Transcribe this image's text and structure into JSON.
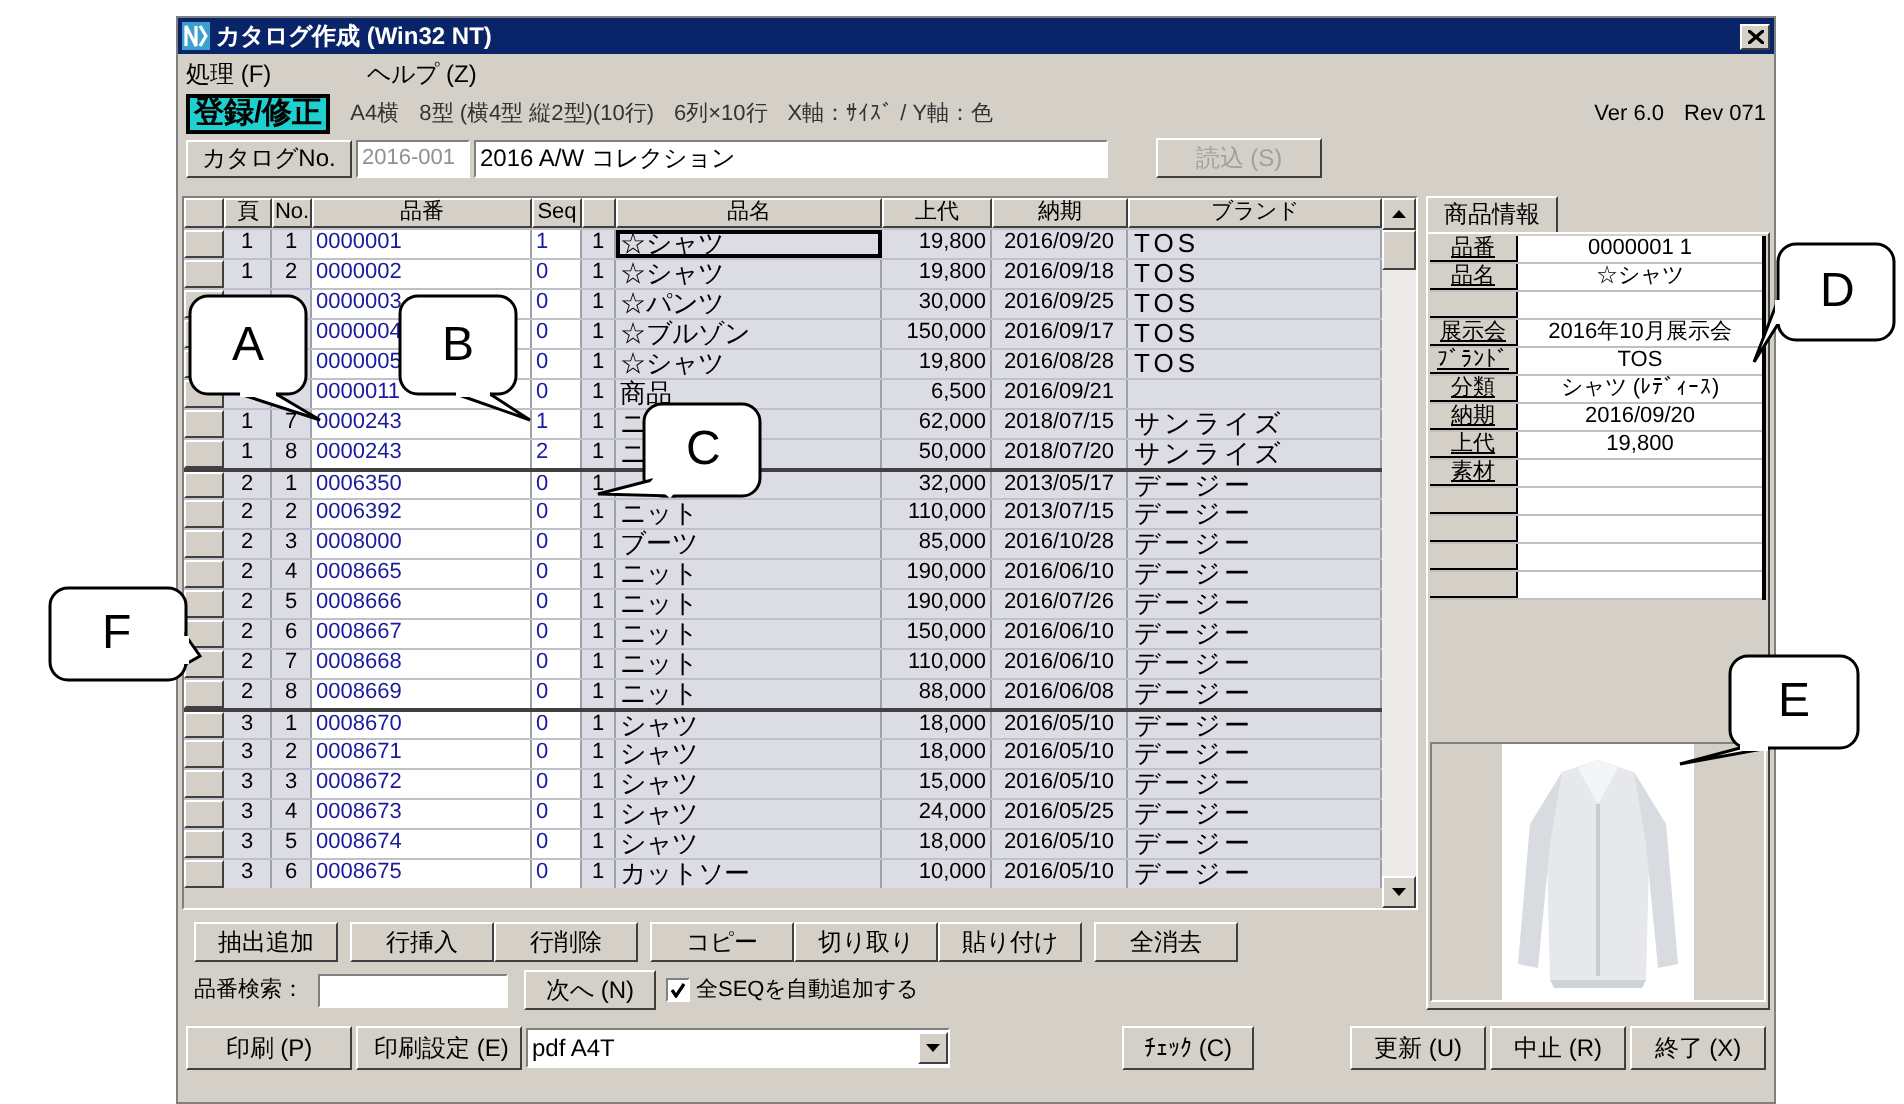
{
  "window": {
    "title": "カタログ作成 (Win32 NT)"
  },
  "menu": [
    {
      "label": "処理 (F)"
    },
    {
      "label": "ヘルプ (Z)"
    }
  ],
  "mode": {
    "label": "登録/修正",
    "info": [
      "A4横",
      "8型 (横4型 縦2型)(10行)",
      "6列×10行",
      "X軸：ｻｲｽﾞ / Y軸：色"
    ],
    "version": "Ver 6.0",
    "revision": "Rev 071"
  },
  "catalog": {
    "label": "カタログNo.",
    "number": "2016-001",
    "name": "2016 A/W コレクション",
    "load_button": {
      "label": "読込 (S)",
      "disabled": true
    }
  },
  "table": {
    "columns": [
      "頁",
      "No.",
      "品番",
      "Seq",
      "品名",
      "上代",
      "納期",
      "ブランド"
    ],
    "rows": [
      {
        "page": "1",
        "no": "1",
        "code": "0000001",
        "seq": "1",
        "qty": "1",
        "name": "☆シャツ",
        "price": "19,800",
        "date": "2016/09/20",
        "brand": "TOS",
        "selected": true
      },
      {
        "page": "1",
        "no": "2",
        "code": "0000002",
        "seq": "0",
        "qty": "1",
        "name": "☆シャツ",
        "price": "19,800",
        "date": "2016/09/18",
        "brand": "TOS",
        "selected": false
      },
      {
        "code": "0000003",
        "seq": "0",
        "qty": "1",
        "name": "☆パンツ",
        "price": "30,000",
        "date": "2016/09/25",
        "brand": "TOS",
        "selected": false
      },
      {
        "code": "0000004",
        "seq": "0",
        "qty": "1",
        "name": "☆ブルゾン",
        "price": "150,000",
        "date": "2016/09/17",
        "brand": "TOS",
        "selected": false
      },
      {
        "code": "0000005",
        "seq": "0",
        "qty": "1",
        "name": "☆シャツ",
        "price": "19,800",
        "date": "2016/08/28",
        "brand": "TOS",
        "selected": false
      },
      {
        "code": "0000011",
        "seq": "0",
        "qty": "1",
        "name": "商品",
        "price": "6,500",
        "date": "2016/09/21",
        "selected": false
      },
      {
        "page": "1",
        "no": "7",
        "code": "0000243",
        "seq": "1",
        "qty": "1",
        "name": "ニ",
        "price": "62,000",
        "date": "2018/07/15",
        "brand": "サンライズ",
        "selected": false
      },
      {
        "page": "1",
        "no": "8",
        "code": "0000243",
        "seq": "2",
        "qty": "1",
        "name": "ニ",
        "price": "50,000",
        "date": "2018/07/20",
        "brand": "サンライズ",
        "selected": false
      },
      {
        "page": "2",
        "no": "1",
        "code": "0006350",
        "seq": "0",
        "qty": "1",
        "price": "32,000",
        "date": "2013/05/17",
        "brand": "デージー",
        "selected": false
      },
      {
        "page": "2",
        "no": "2",
        "code": "0006392",
        "seq": "0",
        "qty": "1",
        "name": "ニット",
        "price": "110,000",
        "date": "2013/07/15",
        "brand": "デージー",
        "selected": false
      },
      {
        "page": "2",
        "no": "3",
        "code": "0008000",
        "seq": "0",
        "qty": "1",
        "name": "ブーツ",
        "price": "85,000",
        "date": "2016/10/28",
        "brand": "デージー",
        "selected": false
      },
      {
        "page": "2",
        "no": "4",
        "code": "0008665",
        "seq": "0",
        "qty": "1",
        "name": "ニット",
        "price": "190,000",
        "date": "2016/06/10",
        "brand": "デージー",
        "selected": false
      },
      {
        "page": "2",
        "no": "5",
        "code": "0008666",
        "seq": "0",
        "qty": "1",
        "name": "ニット",
        "price": "190,000",
        "date": "2016/07/26",
        "brand": "デージー",
        "selected": false
      },
      {
        "page": "2",
        "no": "6",
        "code": "0008667",
        "seq": "0",
        "qty": "1",
        "name": "ニット",
        "price": "150,000",
        "date": "2016/06/10",
        "brand": "デージー",
        "selected": false
      },
      {
        "page": "2",
        "no": "7",
        "code": "0008668",
        "seq": "0",
        "qty": "1",
        "name": "ニット",
        "price": "110,000",
        "date": "2016/06/10",
        "brand": "デージー",
        "selected": false
      },
      {
        "page": "2",
        "no": "8",
        "code": "0008669",
        "seq": "0",
        "qty": "1",
        "name": "ニット",
        "price": "88,000",
        "date": "2016/06/08",
        "brand": "デージー",
        "selected": false
      },
      {
        "page": "3",
        "no": "1",
        "code": "0008670",
        "seq": "0",
        "qty": "1",
        "name": "シャツ",
        "price": "18,000",
        "date": "2016/05/10",
        "brand": "デージー",
        "selected": false
      },
      {
        "page": "3",
        "no": "2",
        "code": "0008671",
        "seq": "0",
        "qty": "1",
        "name": "シャツ",
        "price": "18,000",
        "date": "2016/05/10",
        "brand": "デージー",
        "selected": false
      },
      {
        "page": "3",
        "no": "3",
        "code": "0008672",
        "seq": "0",
        "qty": "1",
        "name": "シャツ",
        "price": "15,000",
        "date": "2016/05/10",
        "brand": "デージー",
        "selected": false
      },
      {
        "page": "3",
        "no": "4",
        "code": "0008673",
        "seq": "0",
        "qty": "1",
        "name": "シャツ",
        "price": "24,000",
        "date": "2016/05/25",
        "brand": "デージー",
        "selected": false
      },
      {
        "page": "3",
        "no": "5",
        "code": "0008674",
        "seq": "0",
        "qty": "1",
        "name": "シャツ",
        "price": "18,000",
        "date": "2016/05/10",
        "brand": "デージー",
        "selected": false
      },
      {
        "page": "3",
        "no": "6",
        "code": "0008675",
        "seq": "0",
        "qty": "1",
        "name": "カットソー",
        "price": "10,000",
        "date": "2016/05/10",
        "brand": "デージー",
        "selected": false
      }
    ]
  },
  "product_panel": {
    "tab": {
      "label": "商品情報",
      "selected": true
    },
    "properties": [
      {
        "kind": "field",
        "label": "品番",
        "value": "0000001 1"
      },
      {
        "kind": "field",
        "label": "品名",
        "value": "☆シャツ"
      },
      {
        "kind": "blank"
      },
      {
        "kind": "field",
        "label": "展示会",
        "value": "2016年10月展示会"
      },
      {
        "kind": "field",
        "label": "ﾌﾞﾗﾝﾄﾞ",
        "value": "TOS"
      },
      {
        "kind": "field",
        "label": "分類",
        "value": "シャツ (ﾚﾃﾞｨｰｽ)"
      },
      {
        "kind": "field",
        "label": "納期",
        "value": "2016/09/20"
      },
      {
        "kind": "field",
        "label": "上代",
        "value": "19,800"
      },
      {
        "kind": "field",
        "label": "素材"
      },
      {
        "kind": "blank"
      },
      {
        "kind": "blank"
      },
      {
        "kind": "blank"
      },
      {
        "kind": "blank"
      }
    ]
  },
  "edit_buttons": [
    [
      "抽出追加"
    ],
    [
      "行挿入",
      "行削除"
    ],
    [
      "コピー",
      "切り取り",
      "貼り付け"
    ],
    [
      "全消去"
    ]
  ],
  "search": {
    "label": "品番検索：",
    "next_button": "次へ (N)",
    "auto_add": {
      "label": "全SEQを自動追加する",
      "checked": true
    }
  },
  "bottom_bar": {
    "print": "印刷 (P)",
    "print_settings": "印刷設定 (E)",
    "printer": "pdf A4T",
    "check": "ﾁｪｯｸ (C)",
    "actions": [
      "更新 (U)",
      "中止 (R)",
      "終了 (X)"
    ]
  },
  "callouts": [
    {
      "letter": "A"
    },
    {
      "letter": "B"
    },
    {
      "letter": "C"
    },
    {
      "letter": "D"
    },
    {
      "letter": "E"
    },
    {
      "letter": "F"
    }
  ]
}
